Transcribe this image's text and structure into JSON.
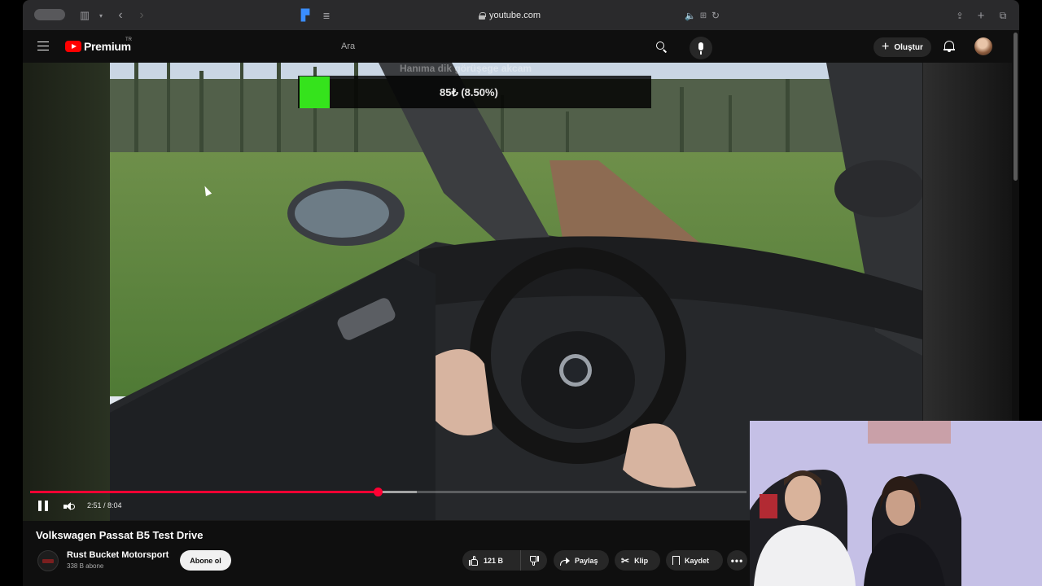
{
  "browser": {
    "url": "youtube.com"
  },
  "header": {
    "logo_text": "Premium",
    "logo_region": "TR",
    "search_placeholder": "Ara",
    "create_label": "Oluştur"
  },
  "video": {
    "overlay_faded_text": "Hanıma dik görüşege akcam",
    "overlay_value": "85₺ (8.50%)",
    "overlay_color": "#35e31c",
    "progress_fraction": 0.486,
    "buffered_fraction": 0.54,
    "time": "2:51 / 8:04",
    "accent_color": "#ff0033"
  },
  "details": {
    "title": "Volkswagen Passat B5 Test Drive",
    "channel_name": "Rust Bucket Motorsport",
    "subscribers": "338 B abone",
    "subscribe_label": "Abone ol",
    "likes": "121 B",
    "share_label": "Paylaş",
    "clip_label": "Klip",
    "save_label": "Kaydet",
    "more_label": "•••"
  }
}
